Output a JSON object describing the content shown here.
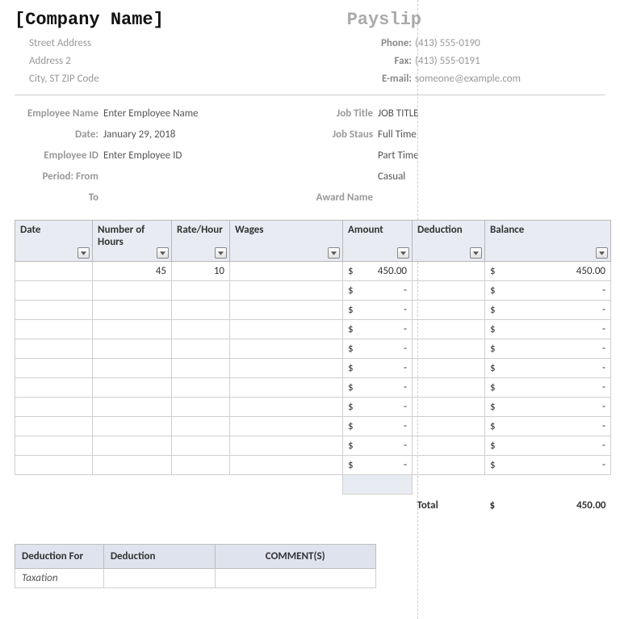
{
  "header": {
    "company": "[Company Name]",
    "title": "Payslip",
    "address": {
      "line1": "Street Address",
      "line2": "Address 2",
      "line3": "City, ST  ZIP Code"
    },
    "contact": {
      "phone_label": "Phone:",
      "phone": "(413) 555-0190",
      "fax_label": "Fax:",
      "fax": "(413) 555-0191",
      "email_label": "E-mail:",
      "email": "someone@example.com"
    }
  },
  "employee": {
    "name_label": "Employee Name",
    "name_value": "Enter Employee Name",
    "date_label": "Date:",
    "date_value": "January 29, 2018",
    "id_label": "Employee ID",
    "id_value": "Enter Employee ID",
    "period_from_label": "Period: From",
    "period_to_label": "To",
    "job_title_label": "Job Title",
    "job_title_value": "JOB TITLE",
    "job_status_label": "Job Staus",
    "status_full": "Full Time",
    "status_part": "Part Time",
    "status_casual": "Casual",
    "award_label": "Award Name"
  },
  "columns": {
    "date": "Date",
    "hours": "Number of Hours",
    "rate": "Rate/Hour",
    "wages": "Wages",
    "amount": "Amount",
    "deduction": "Deduction",
    "balance": "Balance"
  },
  "rows": [
    {
      "hours": "45",
      "rate": "10",
      "amount": "450.00",
      "balance": "450.00"
    },
    {
      "amount": "-",
      "balance": "-"
    },
    {
      "amount": "-",
      "balance": "-"
    },
    {
      "amount": "-",
      "balance": "-"
    },
    {
      "amount": "-",
      "balance": "-"
    },
    {
      "amount": "-",
      "balance": "-"
    },
    {
      "amount": "-",
      "balance": "-"
    },
    {
      "amount": "-",
      "balance": "-"
    },
    {
      "amount": "-",
      "balance": "-"
    },
    {
      "amount": "-",
      "balance": "-"
    },
    {
      "amount": "-",
      "balance": "-"
    }
  ],
  "totals": {
    "label": "Total",
    "balance": "450.00"
  },
  "deduction_table": {
    "col1": "Deduction For",
    "col2": "Deduction",
    "col3": "COMMENT(S)",
    "row1": "Taxation"
  },
  "currency": "$"
}
